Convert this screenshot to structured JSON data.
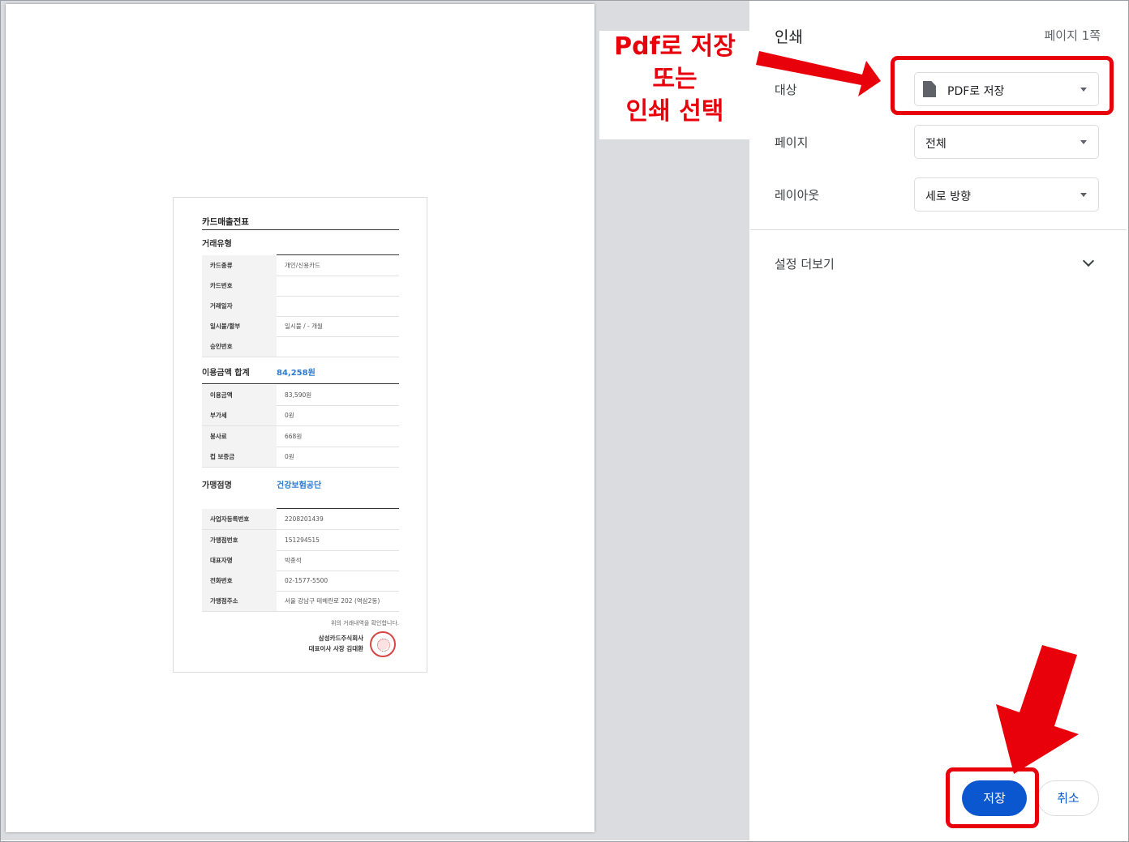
{
  "preview": {
    "receipt": {
      "title": "카드매출전표",
      "section_type": "거래유형",
      "rows_type": [
        {
          "key": "카드종류",
          "value": "개인/신용카드"
        },
        {
          "key": "카드번호",
          "value": ""
        },
        {
          "key": "거래일자",
          "value": ""
        },
        {
          "key": "일시불/할부",
          "value": "일시불 / - 개월"
        },
        {
          "key": "승인번호",
          "value": ""
        }
      ],
      "section_total": "이용금액 합계",
      "total_amount": "84,258원",
      "rows_amount": [
        {
          "key": "이용금액",
          "value": "83,590원"
        },
        {
          "key": "부가세",
          "value": "0원"
        },
        {
          "key": "봉사료",
          "value": "668원"
        },
        {
          "key": "컵 보증금",
          "value": "0원"
        }
      ],
      "section_merchant": "가맹점명",
      "merchant_name": "건강보험공단",
      "rows_merchant": [
        {
          "key": "사업자등록번호",
          "value": "2208201439"
        },
        {
          "key": "가맹점번호",
          "value": "151294515"
        },
        {
          "key": "대표자명",
          "value": "박종석"
        },
        {
          "key": "전화번호",
          "value": "02-1577-5500"
        },
        {
          "key": "가맹점주소",
          "value": "서울 강남구 테헤란로 202 (역삼2동)"
        }
      ],
      "confirm_text": "위의 거래내역을 확인합니다.",
      "company": "삼성카드주식회사",
      "ceo": "대표이사 사장 김대환"
    }
  },
  "annotation": {
    "line1": "Pdf로 저장",
    "line2": "또는",
    "line3": "인쇄 선택",
    "color": "#e8000b"
  },
  "panel": {
    "title": "인쇄",
    "page_count": "페이지 1쪽",
    "destination_label": "대상",
    "destination_value": "PDF로 저장",
    "pages_label": "페이지",
    "pages_value": "전체",
    "layout_label": "레이아웃",
    "layout_value": "세로 방향",
    "more_settings": "설정 더보기",
    "save_button": "저장",
    "cancel_button": "취소",
    "accent": "#0b57d0"
  }
}
